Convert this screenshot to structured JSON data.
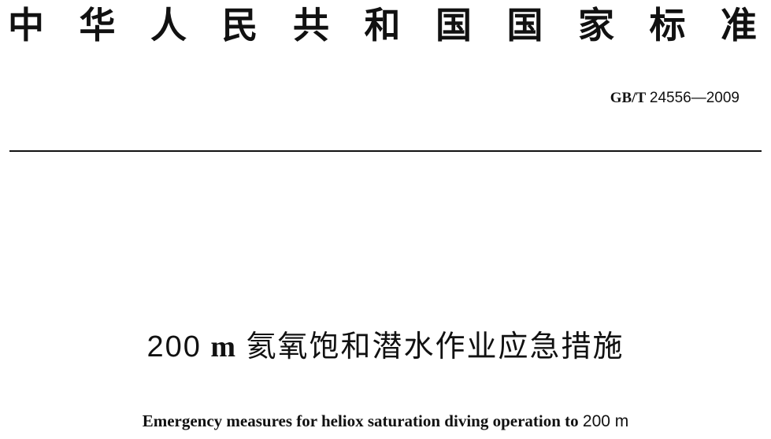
{
  "header": {
    "title": "中华人民共和国国家标准",
    "chars": [
      "中",
      "华",
      "人",
      "民",
      "共",
      "和",
      "国",
      "国",
      "家",
      "标",
      "准"
    ]
  },
  "standard": {
    "prefix": "GB/T",
    "code": "24556—2009"
  },
  "title_zh": {
    "number": "200",
    "unit": "m",
    "text": "氦氧饱和潜水作业应急措施"
  },
  "title_en": {
    "text": "Emergency measures for heliox saturation diving operation to",
    "depth": "200 m"
  },
  "colors": {
    "text": "#111111",
    "background": "#ffffff"
  }
}
